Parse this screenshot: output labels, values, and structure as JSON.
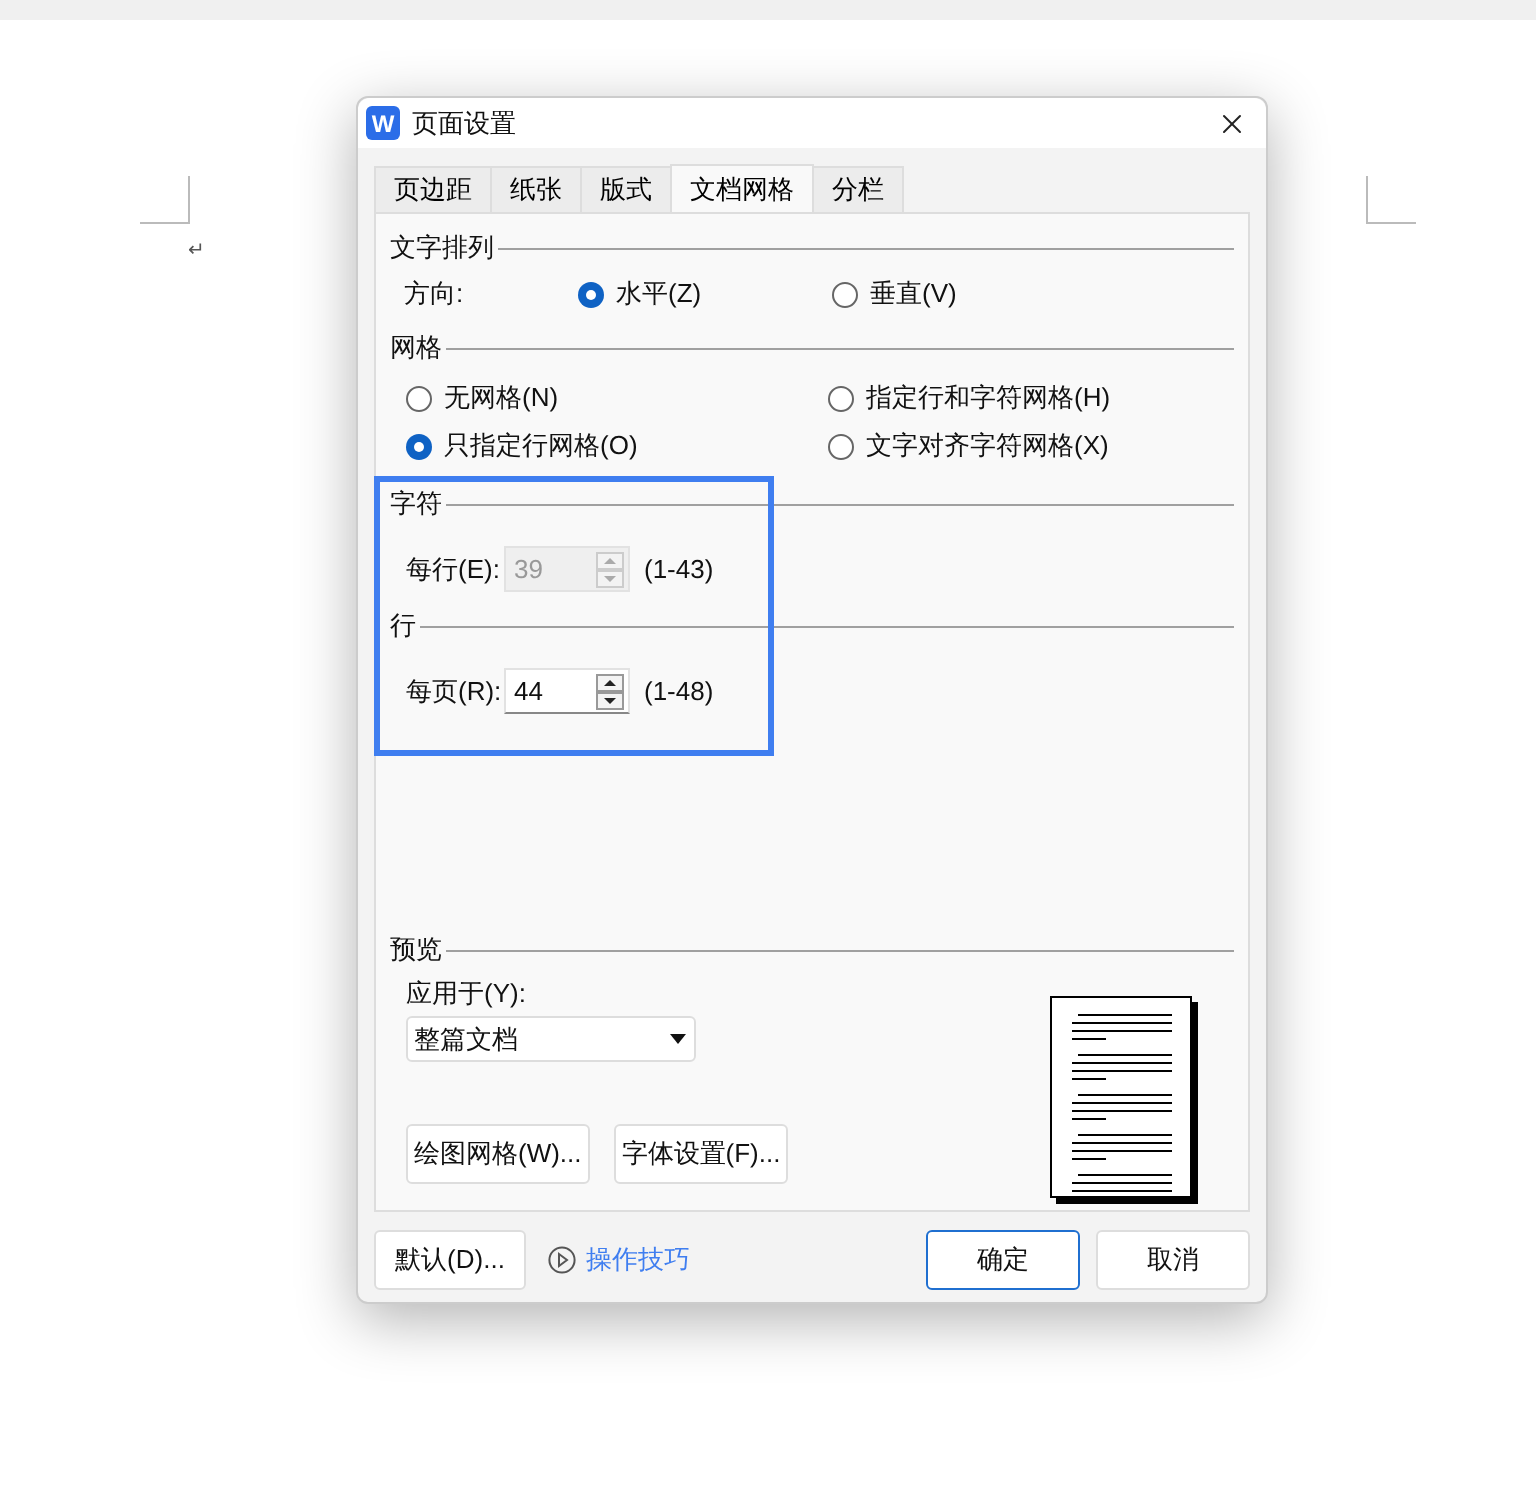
{
  "page": {
    "paragraph_mark": "↵"
  },
  "dialog": {
    "app_icon": "W",
    "title": "页面设置"
  },
  "tabs": [
    {
      "label": "页边距",
      "selected": false
    },
    {
      "label": "纸张",
      "selected": false
    },
    {
      "label": "版式",
      "selected": false
    },
    {
      "label": "文档网格",
      "selected": true
    },
    {
      "label": "分栏",
      "selected": false
    }
  ],
  "text_direction": {
    "heading": "文字排列",
    "label": "方向:",
    "options": [
      {
        "label": "水平(Z)",
        "selected": true
      },
      {
        "label": "垂直(V)",
        "selected": false
      }
    ]
  },
  "grid": {
    "heading": "网格",
    "options": [
      {
        "label": "无网格(N)",
        "selected": false
      },
      {
        "label": "指定行和字符网格(H)",
        "selected": false
      },
      {
        "label": "只指定行网格(O)",
        "selected": true
      },
      {
        "label": "文字对齐字符网格(X)",
        "selected": false
      }
    ]
  },
  "characters": {
    "heading": "字符",
    "label": "每行(E):",
    "value": "39",
    "disabled": true,
    "range": "(1-43)"
  },
  "lines": {
    "heading": "行",
    "label": "每页(R):",
    "value": "44",
    "disabled": false,
    "range": "(1-48)"
  },
  "preview": {
    "heading": "预览",
    "apply_label": "应用于(Y):",
    "apply_value": "整篇文档",
    "buttons": [
      "绘图网格(W)...",
      "字体设置(F)..."
    ]
  },
  "footer": {
    "default_button": "默认(D)...",
    "tips_link": "操作技巧",
    "ok_button": "确定",
    "cancel_button": "取消"
  }
}
